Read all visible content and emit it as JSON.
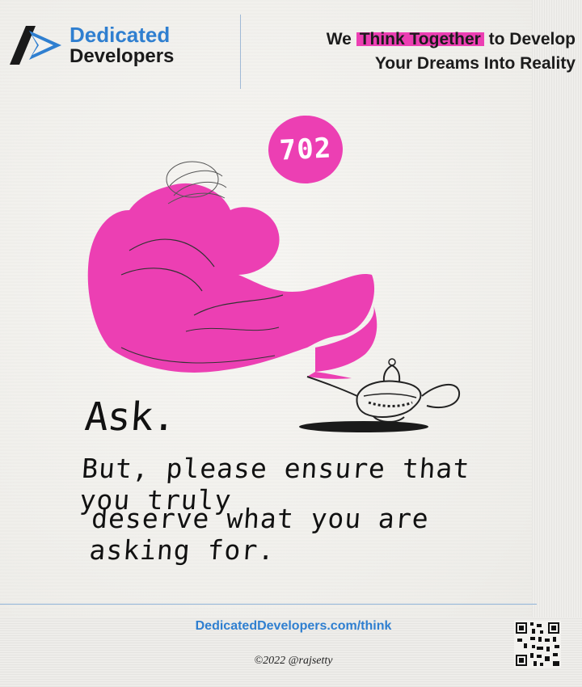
{
  "brand": {
    "name_line1": "Dedicated",
    "name_line2": "Developers",
    "logo_icon": "dedicated-developers-logo",
    "accent_color": "#2f7fd0",
    "dark_color": "#1a1a1a"
  },
  "tagline": {
    "pre": "We",
    "highlight": "Think Together",
    "post_line1": "to Develop",
    "line2": "Your Dreams Into Reality",
    "highlight_color": "#ec3fb3"
  },
  "card": {
    "number": "702",
    "badge_color": "#ec3fb3",
    "illustration_icon": "magic-lamp-genie-icon",
    "title": "Ask.",
    "message_line1": "But, please ensure that you truly",
    "message_line2": "deserve what you are asking for."
  },
  "footer": {
    "url": "DedicatedDevelopers.com/think",
    "copyright": "©2022 @rajsetty",
    "qr_icon": "qr-code-icon"
  }
}
